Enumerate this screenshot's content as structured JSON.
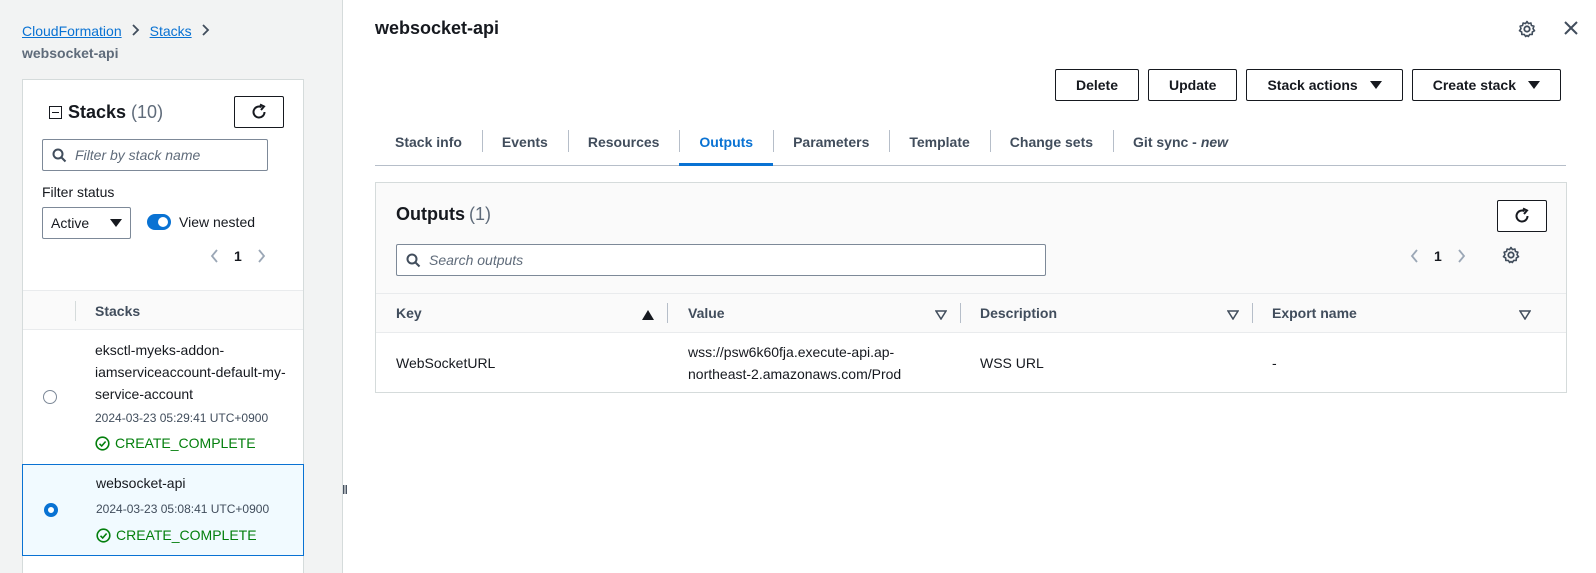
{
  "breadcrumb": {
    "items": [
      "CloudFormation",
      "Stacks"
    ],
    "current": "websocket-api"
  },
  "stacks_panel": {
    "title": "Stacks",
    "count": "(10)",
    "filter_placeholder": "Filter by stack name",
    "filter_status_label": "Filter status",
    "filter_status_value": "Active",
    "view_nested_label": "View nested",
    "page_number": "1",
    "column_header": "Stacks",
    "stacks": [
      {
        "name": "eksctl-myeks-addon-iamserviceaccount-default-my-service-account",
        "timestamp": "2024-03-23 05:29:41 UTC+0900",
        "status": "CREATE_COMPLETE",
        "selected": false
      },
      {
        "name": "websocket-api",
        "timestamp": "2024-03-23 05:08:41 UTC+0900",
        "status": "CREATE_COMPLETE",
        "selected": true
      }
    ]
  },
  "detail": {
    "title": "websocket-api",
    "actions": {
      "delete": "Delete",
      "update": "Update",
      "stack_actions": "Stack actions",
      "create_stack": "Create stack"
    },
    "tabs": [
      {
        "label": "Stack info",
        "active": false
      },
      {
        "label": "Events",
        "active": false
      },
      {
        "label": "Resources",
        "active": false
      },
      {
        "label": "Outputs",
        "active": true
      },
      {
        "label": "Parameters",
        "active": false
      },
      {
        "label": "Template",
        "active": false
      },
      {
        "label": "Change sets",
        "active": false
      },
      {
        "label": "Git sync - ",
        "suffix": "new",
        "active": false
      }
    ]
  },
  "outputs": {
    "title": "Outputs",
    "count": "(1)",
    "search_placeholder": "Search outputs",
    "page_number": "1",
    "columns": [
      "Key",
      "Value",
      "Description",
      "Export name"
    ],
    "rows": [
      {
        "key": "WebSocketURL",
        "value_line1": "wss://psw6k60fja.execute-api.ap-",
        "value_line2": "northeast-2.amazonaws.com/Prod",
        "description": "WSS URL",
        "export_name": "-"
      }
    ]
  },
  "colors": {
    "accent": "#0972d3",
    "success": "#037f0c",
    "text": "#16191f"
  }
}
